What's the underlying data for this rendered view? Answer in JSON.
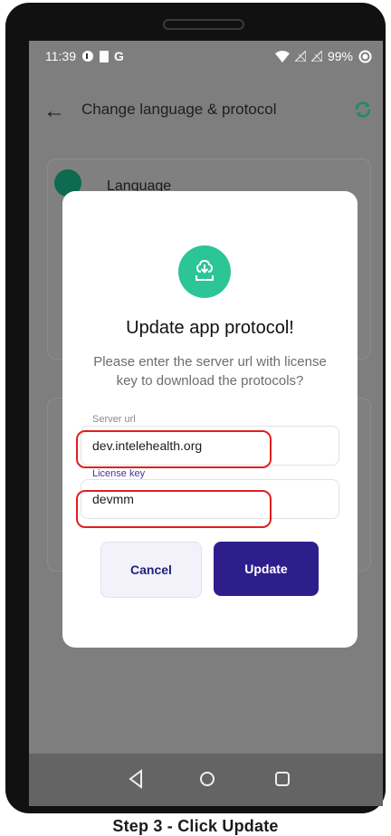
{
  "status_bar": {
    "time": "11:39",
    "icons_left": [
      "status-icon",
      "sim-icon",
      "google-icon"
    ],
    "g_letter": "G",
    "battery_percent": "99%"
  },
  "app_bar": {
    "title": "Change language & protocol"
  },
  "background": {
    "language_label": "Language"
  },
  "dialog": {
    "title": "Update app protocol!",
    "message": "Please enter the server url with license key to download the protocols?",
    "server_url": {
      "label": "Server url",
      "value": "dev.intelehealth.org"
    },
    "license_key": {
      "label": "License key",
      "value": "devmm"
    },
    "cancel_label": "Cancel",
    "update_label": "Update"
  },
  "colors": {
    "accent_green": "#2cc595",
    "primary": "#2e1e8c",
    "highlight": "#e02020"
  },
  "caption": "Step 3 - Click Update"
}
